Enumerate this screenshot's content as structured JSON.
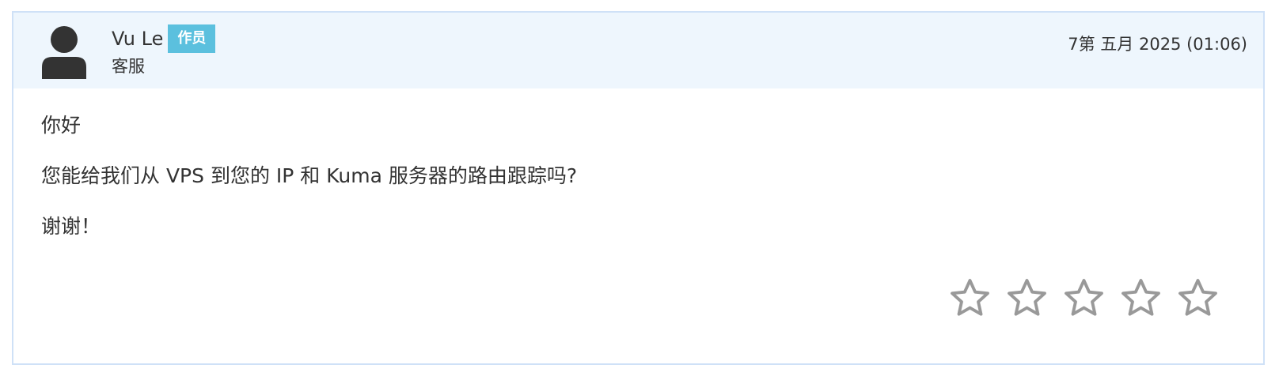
{
  "reply": {
    "author_name": "Vu Le",
    "badge": "作员",
    "role": "客服",
    "timestamp": "7第 五月 2025 (01:06)",
    "message": [
      "你好",
      "您能给我们从 VPS 到您的 IP 和 Kuma 服务器的路由跟踪吗?",
      "谢谢！"
    ]
  },
  "rating": {
    "stars": 5,
    "selected": 0
  },
  "colors": {
    "header_bg": "#eef6fd",
    "border": "#cfe1f7",
    "badge_bg": "#5bc0de",
    "star_outline": "#999999",
    "avatar": "#333333"
  },
  "icons": {
    "avatar": "user-silhouette-icon",
    "star": "star-outline-icon"
  }
}
